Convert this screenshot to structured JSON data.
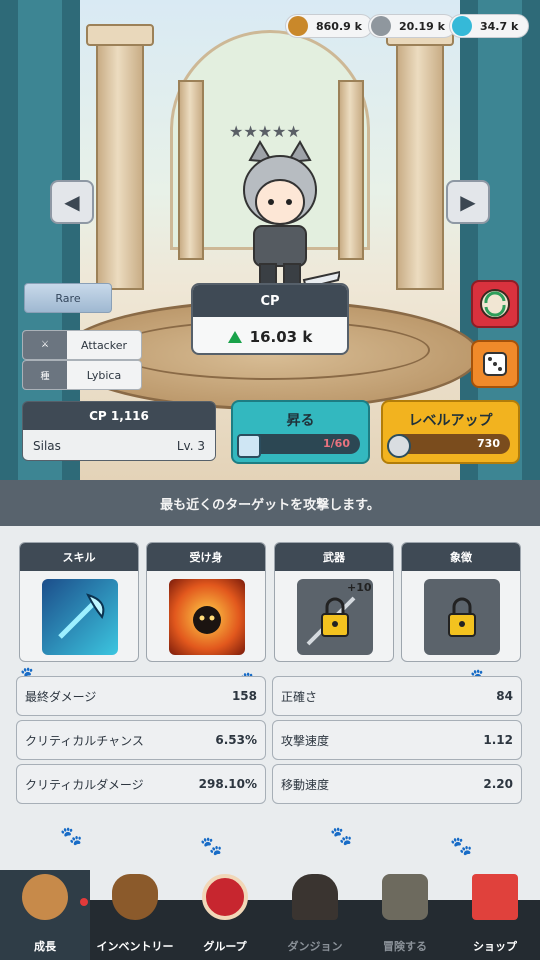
{
  "currencies": [
    {
      "value": "860.9 k",
      "icon": "gold-coin-icon",
      "color": "#c9882a"
    },
    {
      "value": "20.19 k",
      "icon": "silver-medal-icon",
      "color": "#8f979e"
    },
    {
      "value": "34.7 k",
      "icon": "diamond-icon",
      "color": "#35b9d8"
    }
  ],
  "hero": {
    "stars": "★★★★★",
    "rarity": "Rare",
    "role_label": "Attacker",
    "race_tag": "種",
    "race_label": "Lybica",
    "name": "Silas",
    "level": "Lv. 3",
    "cp_title": "CP 1,116"
  },
  "cp_panel": {
    "title": "CP",
    "value": "16.03 k"
  },
  "ascend": {
    "label": "昇る",
    "progress": "1/60",
    "fraction": 0.017
  },
  "levelup": {
    "label": "レベルアップ",
    "cost": "730"
  },
  "description": "最も近くのターゲットを攻撃します。",
  "slots": [
    {
      "title": "スキル",
      "icon": "axe-skill-icon"
    },
    {
      "title": "受け身",
      "icon": "fire-spirit-icon"
    },
    {
      "title": "武器",
      "icon": "locked-weapon-icon",
      "badge": "+10"
    },
    {
      "title": "象徴",
      "icon": "lock-icon"
    }
  ],
  "stats": [
    {
      "label": "最終ダメージ",
      "value": "158"
    },
    {
      "label": "正確さ",
      "value": "84"
    },
    {
      "label": "クリティカルチャンス",
      "value": "6.53%"
    },
    {
      "label": "攻撃速度",
      "value": "1.12"
    },
    {
      "label": "クリティカルダメージ",
      "value": "298.10%"
    },
    {
      "label": "移動速度",
      "value": "2.20"
    }
  ],
  "nav": [
    {
      "label": "成長",
      "icon": "cat-growth-icon"
    },
    {
      "label": "インベントリー",
      "icon": "bag-icon"
    },
    {
      "label": "グループ",
      "icon": "circle-arrow-icon"
    },
    {
      "label": "ダンジョン",
      "icon": "dungeon-door-icon"
    },
    {
      "label": "冒険する",
      "icon": "map-icon"
    },
    {
      "label": "ショップ",
      "icon": "shop-icon"
    }
  ],
  "colors": {
    "accent_teal": "#33b8bf",
    "accent_gold": "#f2b31f",
    "panel_dark": "#3f4a55",
    "up_green": "#19a24a"
  }
}
